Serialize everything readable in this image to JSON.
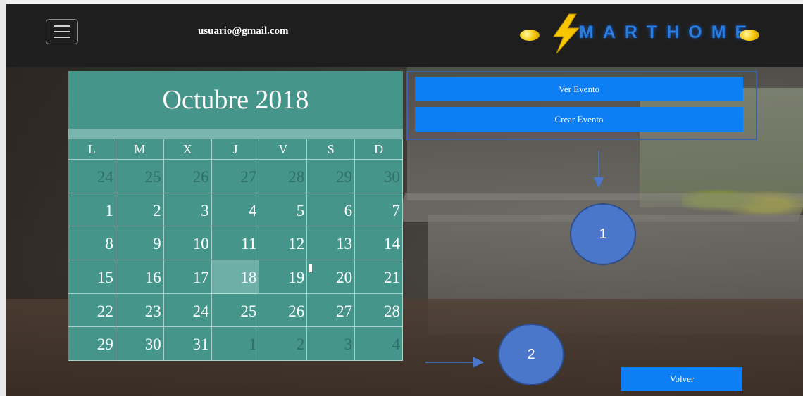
{
  "header": {
    "user_email": "usuario@gmail.com",
    "logo_text": "MARTHOME"
  },
  "calendar": {
    "title": "Octubre 2018",
    "weekdays": [
      "L",
      "M",
      "X",
      "J",
      "V",
      "S",
      "D"
    ],
    "weeks": [
      [
        "24",
        "25",
        "26",
        "27",
        "28",
        "29",
        "30"
      ],
      [
        "1",
        "2",
        "3",
        "4",
        "5",
        "6",
        "7"
      ],
      [
        "8",
        "9",
        "10",
        "11",
        "12",
        "13",
        "14"
      ],
      [
        "15",
        "16",
        "17",
        "18",
        "19",
        "20",
        "21"
      ],
      [
        "22",
        "23",
        "24",
        "25",
        "26",
        "27",
        "28"
      ],
      [
        "29",
        "30",
        "31",
        "1",
        "2",
        "3",
        "4"
      ]
    ],
    "today": "18"
  },
  "actions": {
    "ver_evento": "Ver Evento",
    "crear_evento": "Crear Evento",
    "volver": "Volver"
  },
  "annotations": {
    "callout_1": "1",
    "callout_2": "2"
  },
  "colors": {
    "navbar": "#1e1e1e",
    "calendar": "#45958b",
    "button": "#0e7ef5",
    "callout": "#4a77c9"
  }
}
